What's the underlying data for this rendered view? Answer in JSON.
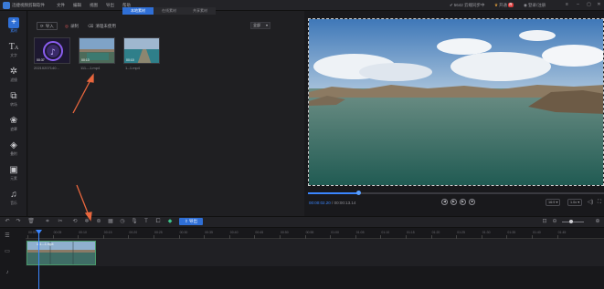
{
  "titlebar": {
    "app_title": "迅捷视频剪辑软件",
    "menus": [
      "文件",
      "编辑",
      "视图",
      "导出",
      "帮助"
    ],
    "right_items": [
      {
        "icon": "check-icon",
        "label": "5642 云端同步中"
      },
      {
        "icon": "vip-icon",
        "label": "开通",
        "badge": "荐"
      },
      {
        "icon": "avatar-icon",
        "label": "登录/注册"
      }
    ]
  },
  "nav": [
    {
      "icon": "media-icon",
      "label": "素材",
      "active": true
    },
    {
      "icon": "text-icon",
      "label": "文字"
    },
    {
      "icon": "filter-icon",
      "label": "滤镜"
    },
    {
      "icon": "transition-icon",
      "label": "转场"
    },
    {
      "icon": "overlay-icon",
      "label": "遮罩"
    },
    {
      "icon": "layers-icon",
      "label": "叠附"
    },
    {
      "icon": "element-icon",
      "label": "元素"
    },
    {
      "icon": "music-icon",
      "label": "音乐"
    }
  ],
  "media": {
    "tabs": [
      "本地素材",
      "在线素材",
      "共享素材"
    ],
    "import_label": "导入",
    "record_label": "录制",
    "clear_label": "清理未使用",
    "filter_value": "全部",
    "items": [
      {
        "name": "20210207140...",
        "duration": "00:37"
      },
      {
        "name": "111---1.mp4",
        "duration": "00:13"
      },
      {
        "name": "1--1.mp4",
        "duration": "00:10"
      }
    ]
  },
  "preview": {
    "current_time": "00:00:02.20",
    "total_time": "00:00:13.14",
    "ratio_label": "16:9",
    "speed_label": "1.0x",
    "progress": 0.17
  },
  "toolbar": {
    "export_label": "导出"
  },
  "timeline": {
    "ticks": [
      "00:00",
      "00:05",
      "00:10",
      "00:15",
      "00:20",
      "00:25",
      "00:30",
      "00:35",
      "00:40",
      "00:45",
      "00:50",
      "00:55",
      "01:00",
      "01:05",
      "01:10",
      "01:15",
      "01:20",
      "01:25",
      "01:30",
      "01:35",
      "01:40",
      "01:45"
    ],
    "clip_label": "111---1.mp4"
  },
  "colors": {
    "accent": "#2f6fd6",
    "annotation_arrow": "#e8663d",
    "clip_border": "#4a9a6a"
  }
}
